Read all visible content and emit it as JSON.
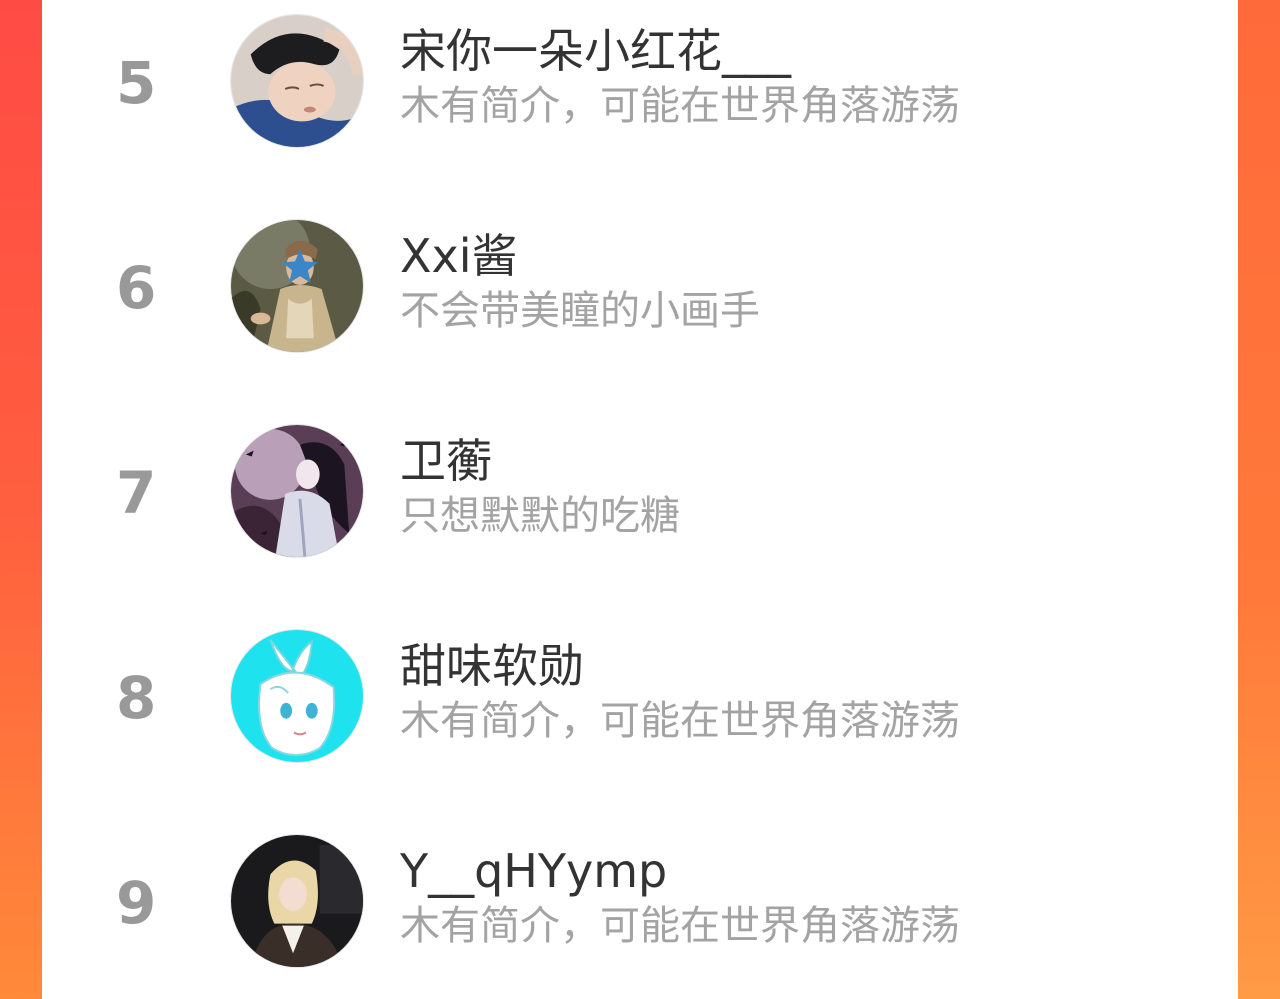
{
  "ranking": {
    "entries": [
      {
        "rank": "5",
        "name": "宋你一朵小红花___",
        "bio": "木有简介，可能在世界角落游荡",
        "avatar_icon": "sleeping-boy-photo"
      },
      {
        "rank": "6",
        "name": "Xxi酱",
        "bio": "不会带美瞳的小画手",
        "avatar_icon": "painting-portrait-star-mask"
      },
      {
        "rank": "7",
        "name": "卫蘅",
        "bio": "只想默默的吃糖",
        "avatar_icon": "anime-ancient-costume-man"
      },
      {
        "rank": "8",
        "name": "甜味软勋",
        "bio": "木有简介，可能在世界角落游荡",
        "avatar_icon": "anime-girl-bow-cyan"
      },
      {
        "rank": "9",
        "name": "Y__qHYymp",
        "bio": "木有简介，可能在世界角落游荡",
        "avatar_icon": "blonde-girl-photo"
      }
    ]
  },
  "colors": {
    "background_red": "#ff4b45",
    "background_orange": "#ff8a3a",
    "card": "#ffffff",
    "rank_text": "#999999",
    "name_text": "#333333",
    "bio_text": "#a3a3a3"
  }
}
